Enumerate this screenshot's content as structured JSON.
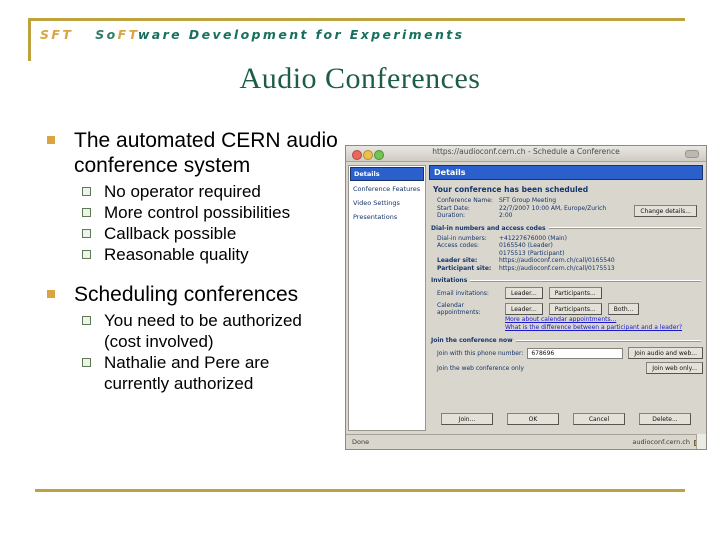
{
  "header": {
    "kicker_sft": "SFT",
    "kicker_so": "So",
    "kicker_ft": "FT",
    "kicker_rest": "ware Development for Experiments",
    "title": "Audio Conferences",
    "rule_color": "#bda33e"
  },
  "content": {
    "bullets": [
      {
        "text": "The automated CERN audio conference system",
        "sub": [
          "No operator required",
          "More control possibilities",
          "Callback possible",
          "Reasonable quality"
        ]
      },
      {
        "text": "Scheduling conferences",
        "sub": [
          "You need to be authorized (cost involved)",
          "Nathalie and Pere are currently authorized"
        ]
      }
    ]
  },
  "screenshot": {
    "window_title": "https://audioconf.cern.ch - Schedule a Conference",
    "traffic_lights": [
      "close-light",
      "minimize-light",
      "zoom-light"
    ],
    "nav": {
      "items": [
        "Details",
        "Conference Features",
        "Video Settings",
        "Presentations"
      ],
      "selected": "Details"
    },
    "pane": {
      "header": "Details",
      "subheader": "Your conference has been scheduled",
      "details": [
        {
          "key": "Conference Name:",
          "value": "SFT Group Meeting"
        },
        {
          "key": "Start Date:",
          "value": "22/7/2007 10:00 AM, Europe/Zurich"
        },
        {
          "key": "Duration:",
          "value": "2:00"
        }
      ],
      "change_details_label": "Change details...",
      "dialin_legend": "Dial-in numbers and access codes",
      "dialin": [
        {
          "key": "Dial-in numbers:",
          "value": "+41227676000 (Main)"
        },
        {
          "key": "Access codes:",
          "value": "0165540 (Leader)"
        },
        {
          "key": "",
          "value": "0175513 (Participant)"
        },
        {
          "key": "Leader site:",
          "value": "https://audioconf.cern.ch/call/0165540"
        },
        {
          "key": "Participant site:",
          "value": "https://audioconf.cern.ch/call/0175513"
        }
      ],
      "invitations_legend": "Invitations",
      "email_invitations_label": "Email invitations:",
      "email_invitations_buttons": [
        "Leader...",
        "Participants..."
      ],
      "calendar_label": "Calendar appointments:",
      "calendar_buttons": [
        "Leader...",
        "Participants...",
        "Both..."
      ],
      "links": [
        "More about calendar appointments...",
        "What is the difference between a participant and a leader?"
      ],
      "join_legend": "Join the conference now",
      "join_phone_label": "Join with this phone number:",
      "join_phone_value": "678696",
      "join_audio_web_label": "Join audio and web...",
      "join_web_only_label": "Join the web conference only",
      "join_web_only_button": "Join web only...",
      "footer_buttons": [
        "Join...",
        "OK",
        "Cancel",
        "Delete..."
      ]
    },
    "status": {
      "left": "Done",
      "host": "audioconf.cern.ch",
      "lock": "lock-icon"
    }
  }
}
